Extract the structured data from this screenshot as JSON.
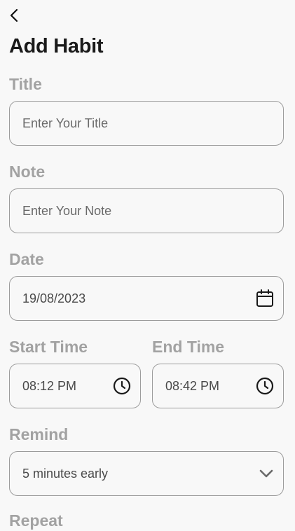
{
  "header": {
    "back_icon": "chevron-left-icon",
    "title": "Add Habit"
  },
  "form": {
    "title": {
      "label": "Title",
      "placeholder": "Enter Your Title"
    },
    "note": {
      "label": "Note",
      "placeholder": "Enter Your Note"
    },
    "date": {
      "label": "Date",
      "value": "19/08/2023",
      "icon": "calendar-icon"
    },
    "start_time": {
      "label": "Start Time",
      "value": "08:12 PM",
      "icon": "clock-icon"
    },
    "end_time": {
      "label": "End Time",
      "value": "08:42 PM",
      "icon": "clock-icon"
    },
    "remind": {
      "label": "Remind",
      "value": "5 minutes early",
      "icon": "chevron-down-icon"
    },
    "repeat": {
      "label": "Repeat"
    }
  }
}
